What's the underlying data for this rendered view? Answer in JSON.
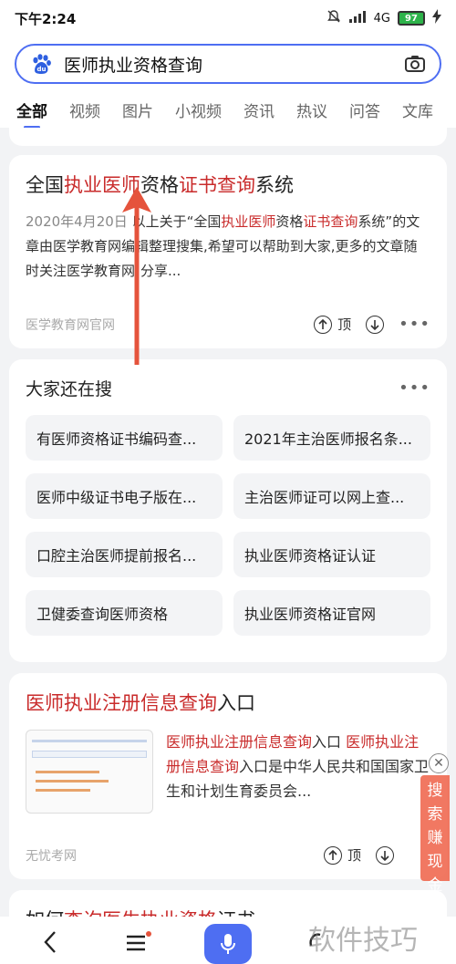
{
  "status": {
    "time": "下午2:24",
    "network": "4G",
    "battery": "97"
  },
  "search": {
    "query": "医师执业资格查询"
  },
  "tabs": [
    "全部",
    "视频",
    "图片",
    "小视频",
    "资讯",
    "热议",
    "问答",
    "文库"
  ],
  "result1": {
    "title_parts": [
      "全国",
      "执业医师",
      "资格",
      "证书查询",
      "系统"
    ],
    "date": "2020年4月20日",
    "abstract_parts": [
      "以上关于“全国",
      "执业医师",
      "资格",
      "证书查询",
      "系统”的文章由医学教育网编辑整理搜集,希望可以帮助到大家,更多的文章随时关注医学教育网!分享..."
    ],
    "source": "医学教育网官网",
    "top_label": "顶"
  },
  "related": {
    "header": "大家还在搜",
    "items": [
      "有医师资格证书编码查...",
      "2021年主治医师报名条...",
      "医师中级证书电子版在...",
      "主治医师证可以网上查...",
      "口腔主治医师提前报名...",
      "执业医师资格证认证",
      "卫健委查询医师资格",
      "执业医师资格证官网"
    ]
  },
  "result2": {
    "title_hl": "医师执业注册信息查询",
    "title_rest": "入口",
    "abs_hl1": "医师执业注册信息查询",
    "abs_t1": "入口 ",
    "abs_hl2": "医师执业注册信息查询",
    "abs_t2": "入口是中华人民共和国国家卫生和计划生育委员会...",
    "source": "无忧考网",
    "top_label": "顶"
  },
  "promo": {
    "text": "搜索赚现金"
  },
  "result3": {
    "title_a": "如何",
    "title_hl": "查询医生执业资格",
    "title_b": "证书..."
  },
  "watermark": "软件技巧",
  "colors": {
    "accent": "#4e6ef2",
    "highlight": "#c92b2b",
    "arrow": "#e5533c"
  }
}
